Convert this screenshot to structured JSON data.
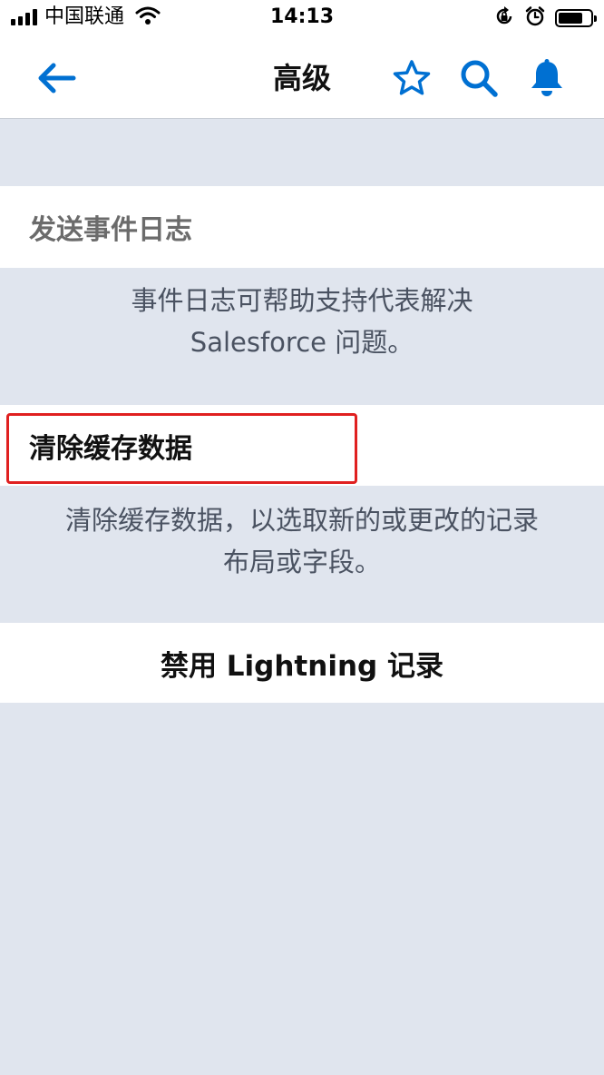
{
  "status_bar": {
    "carrier": "中国联通",
    "time": "14:13"
  },
  "nav": {
    "title": "高级",
    "back_icon": "arrow-left-icon",
    "star_icon": "star-icon",
    "search_icon": "search-icon",
    "bell_icon": "bell-icon",
    "accent_color": "#0070d2"
  },
  "event_log": {
    "header": "发送事件日志",
    "description_line1": "事件日志可帮助支持代表解决",
    "description_line2": "Salesforce 问题。"
  },
  "cache": {
    "label": "清除缓存数据",
    "description_line1": "清除缓存数据，以选取新的或更改的记录",
    "description_line2": "布局或字段。",
    "highlight_color": "#e02020"
  },
  "lightning": {
    "label": "禁用 Lightning 记录"
  }
}
